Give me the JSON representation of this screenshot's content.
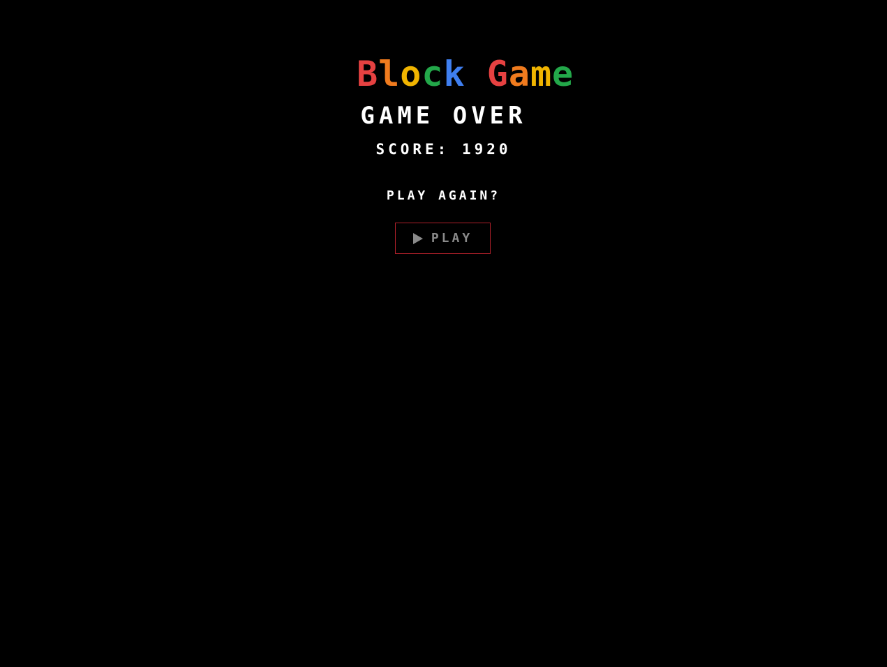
{
  "header": {
    "title_letters": [
      {
        "char": "B",
        "color": "#e64141"
      },
      {
        "char": "l",
        "color": "#f07b1e"
      },
      {
        "char": "o",
        "color": "#f0b400"
      },
      {
        "char": "c",
        "color": "#23a84a"
      },
      {
        "char": "k",
        "color": "#3f7ff0"
      },
      {
        "char": " ",
        "color": "#000000"
      },
      {
        "char": "G",
        "color": "#e64141"
      },
      {
        "char": "a",
        "color": "#f07b1e"
      },
      {
        "char": "m",
        "color": "#f0b400"
      },
      {
        "char": "e",
        "color": "#23a84a"
      }
    ]
  },
  "game_over": {
    "heading": "GAME OVER",
    "score_text": "SCORE: 1920",
    "prompt": "PLAY AGAIN?",
    "play_button": {
      "icon": "play-icon",
      "label": "PLAY",
      "border_color": "#b0202a",
      "text_color": "#8a8a8a"
    }
  },
  "colors": {
    "background": "#000000",
    "text": "#ffffff"
  }
}
